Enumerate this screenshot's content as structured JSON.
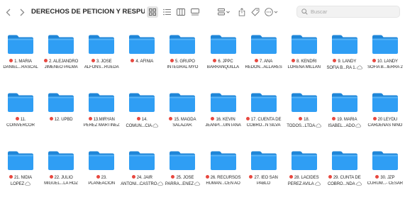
{
  "colors": {
    "folder_body": "#2f9ef4",
    "folder_tab": "#1f86d8",
    "folder_top": "#57b4f7",
    "tag_red": "#e8483f"
  },
  "toolbar": {
    "back_icon": "chevron-left-icon",
    "forward_icon": "chevron-right-icon",
    "title": "DERECHOS DE PETICION Y RESPUESTAS...",
    "views": [
      "icon-view-icon",
      "list-view-icon",
      "column-view-icon",
      "gallery-view-icon"
    ],
    "group_icon": "group-icon",
    "share_icon": "share-icon",
    "tag_icon": "tag-icon",
    "more_icon": "more-icon",
    "search_placeholder": "Buscar"
  },
  "folders": [
    {
      "lines": [
        "1. MARIA",
        "DANIEL...RASCAL"
      ],
      "cloud": false
    },
    {
      "lines": [
        "2. ALEJANDRO",
        "JIMENEO PALMA"
      ],
      "cloud": false
    },
    {
      "lines": [
        "3. JOSE",
        "ALFONS...RUEDA"
      ],
      "cloud": false
    },
    {
      "lines": [
        "4. AFINIA"
      ],
      "cloud": false
    },
    {
      "lines": [
        "5. GRUPO",
        "INTEGRAL MYO"
      ],
      "cloud": false
    },
    {
      "lines": [
        "6. JPPC",
        "BARRANQUILLA"
      ],
      "cloud": false
    },
    {
      "lines": [
        "7. ANA",
        "REDON...ALLARES"
      ],
      "cloud": false
    },
    {
      "lines": [
        "8. KENDRI",
        "LORENA MILLAN"
      ],
      "cloud": false
    },
    {
      "lines": [
        "9. LANDY",
        "SOFIA B...RA 1."
      ],
      "cloud": true
    },
    {
      "lines": [
        "10. LANDY",
        "SOFIA B...IERRA 2"
      ],
      "cloud": false
    },
    {
      "lines": [
        "11.",
        "COINVERCOR"
      ],
      "cloud": false
    },
    {
      "lines": [
        "12. UPBD"
      ],
      "cloud": false
    },
    {
      "lines": [
        "13.MIRYAN",
        "PEREZ MARTINEZ"
      ],
      "cloud": false
    },
    {
      "lines": [
        "14.",
        "COMUN...CIA"
      ],
      "cloud": true
    },
    {
      "lines": [
        "15. MAGDA",
        "SALAZAR."
      ],
      "cloud": false
    },
    {
      "lines": [
        "16. KEVIN",
        "JEANPI...UINTANA"
      ],
      "cloud": false
    },
    {
      "lines": [
        "17. CUENTA DE",
        "COBRO...N SILVA"
      ],
      "cloud": false
    },
    {
      "lines": [
        "18.",
        "TODOS...LTDA"
      ],
      "cloud": true
    },
    {
      "lines": [
        "19. MARIA",
        "ISABEL...ADO"
      ],
      "cloud": true
    },
    {
      "lines": [
        "20 LEYDU",
        "CARDENAS NIÑO"
      ],
      "cloud": false
    },
    {
      "lines": [
        "21. NIDIA",
        "LOPEZ"
      ],
      "cloud": true
    },
    {
      "lines": [
        "22. JULIO",
        "MIGUEL...LA HOZ"
      ],
      "cloud": false
    },
    {
      "lines": [
        "23.",
        "PLANEACION"
      ],
      "cloud": false
    },
    {
      "lines": [
        "24. JAIR",
        "ANTONI...CASTRO"
      ],
      "cloud": true
    },
    {
      "lines": [
        "25. JOSE",
        "PARRA...ENEZ"
      ],
      "cloud": true
    },
    {
      "lines": [
        "26. RECURSOS",
        "HUMAN...CEN AO"
      ],
      "cloud": false
    },
    {
      "lines": [
        "27. IEO SAN",
        "PABLO"
      ],
      "cloud": false
    },
    {
      "lines": [
        "28. LACIDES",
        "PEREZ AVILA"
      ],
      "cloud": true
    },
    {
      "lines": [
        "29. CUNTA DE",
        "COBRO...NDA"
      ],
      "cloud": true
    },
    {
      "lines": [
        "30. JZP",
        "CURUM...- CESAR"
      ],
      "cloud": false
    }
  ]
}
